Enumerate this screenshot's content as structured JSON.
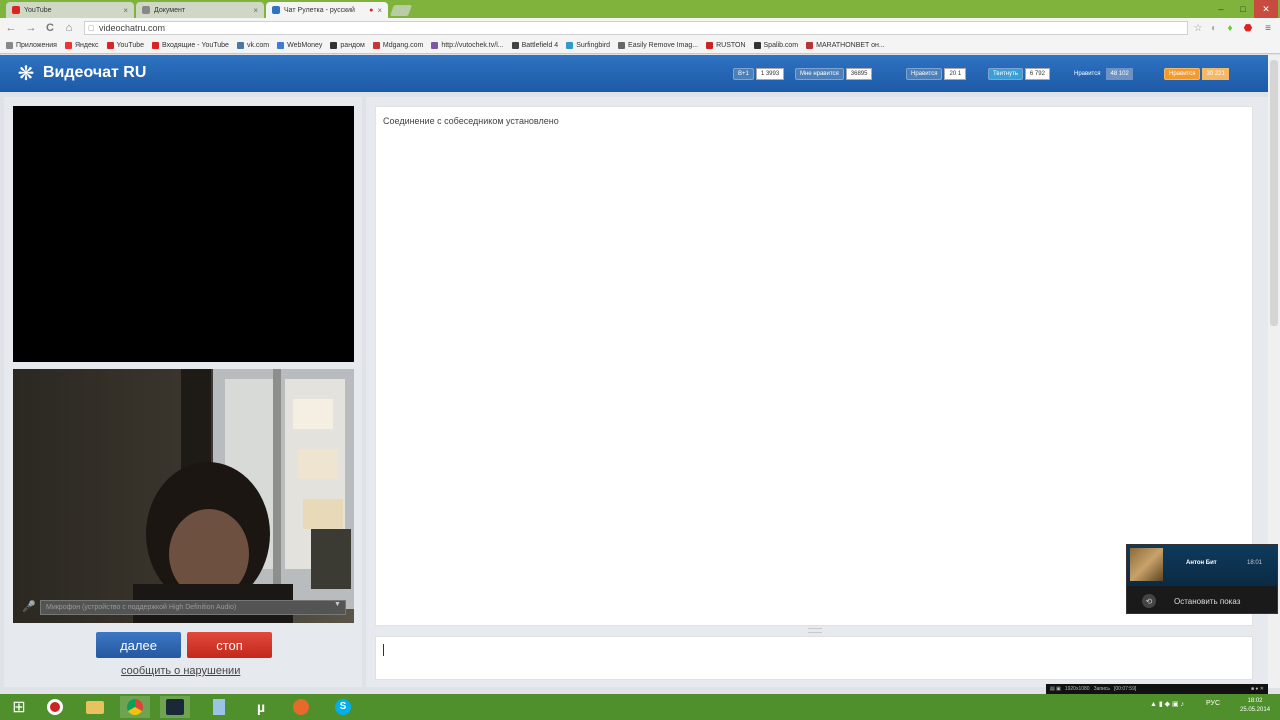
{
  "browser": {
    "tabs": [
      {
        "label": "YouTube",
        "color": "#d22"
      },
      {
        "label": "Документ",
        "color": "#888"
      },
      {
        "label": "Чат Рулетка - русский",
        "color": "#2f73c2",
        "active": true
      }
    ],
    "tab_close_glyph": "×",
    "window_controls": {
      "minimize": "–",
      "maximize": "□",
      "close": "✕"
    },
    "nav": {
      "back": "←",
      "forward": "→",
      "reload": "C",
      "home": "⌂"
    },
    "address": "videochatru.com",
    "bookmarks": [
      {
        "label": "Приложения",
        "color": "#888"
      },
      {
        "label": "Яндекс",
        "color": "#e33"
      },
      {
        "label": "YouTube",
        "color": "#d22"
      },
      {
        "label": "Входящие - YouTube",
        "color": "#d22"
      },
      {
        "label": "vk.com",
        "color": "#4a76a8"
      },
      {
        "label": "WebMoney",
        "color": "#3a7bd5"
      },
      {
        "label": "рандом",
        "color": "#333"
      },
      {
        "label": "Mdgang.com",
        "color": "#c33"
      },
      {
        "label": "http://vutochek.tv/l...",
        "color": "#7a5aa8"
      },
      {
        "label": "Battlefield 4",
        "color": "#444"
      },
      {
        "label": "Surfingbird",
        "color": "#39c"
      },
      {
        "label": "Easily Remove Imag...",
        "color": "#666"
      },
      {
        "label": "RUSTON",
        "color": "#c22"
      },
      {
        "label": "Spalib.com",
        "color": "#333"
      },
      {
        "label": "MARATHONBET он...",
        "color": "#b33"
      }
    ]
  },
  "site": {
    "logo": "Видеочат RU",
    "share": [
      {
        "label": "В+1",
        "count": "1 3993"
      },
      {
        "label": "Мне нравится",
        "count": "36895"
      },
      {
        "label": "Нравится",
        "count": "20 1"
      },
      {
        "label": "Твитнуть",
        "count": "6 792"
      },
      {
        "label": "Нравится",
        "count": "48 102"
      },
      {
        "label": "Нравится",
        "count": "30 221"
      }
    ],
    "mic_select": "Микрофон (устройство с поддержкой High Definition Audio)",
    "next_button": "далее",
    "stop_button": "стоп",
    "report_link": "сообщить о нарушении",
    "chat_status": "Соединение с собеседником установлено"
  },
  "notification": {
    "name": "Антон Бит",
    "time": "18:01",
    "action": "Остановить показ"
  },
  "recorder": {
    "resolution": "1920x1080",
    "label": "Запись",
    "timer": "[00:07:59]"
  },
  "taskbar": {
    "icons": [
      "windows-start",
      "opera",
      "explorer",
      "chrome",
      "steam",
      "notepad",
      "utorrent",
      "firefox",
      "skype"
    ],
    "lang": "РУС",
    "time": "18:02",
    "date": "25.05.2014"
  },
  "colors": {
    "header_blue": "#2f73c2",
    "next_blue": "#2f67b4",
    "stop_red": "#d4382b",
    "taskbar_green": "#4f8f2c"
  }
}
